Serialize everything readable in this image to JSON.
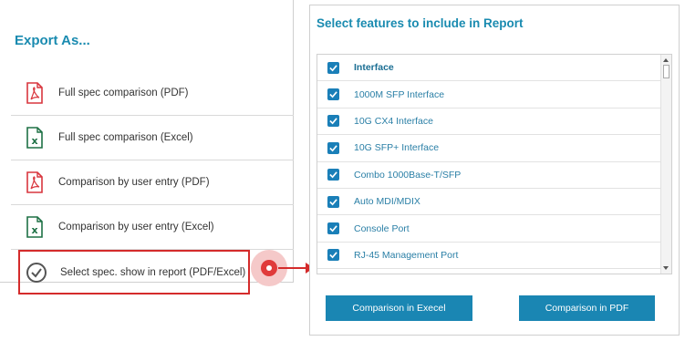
{
  "left_panel": {
    "title": "Export As...",
    "items": [
      {
        "label": "Full spec comparison (PDF)",
        "icon": "pdf-file-icon"
      },
      {
        "label": "Full spec comparison (Excel)",
        "icon": "excel-file-icon"
      },
      {
        "label": "Comparison by user entry (PDF)",
        "icon": "pdf-file-icon"
      },
      {
        "label": "Comparison by user entry (Excel)",
        "icon": "excel-file-icon"
      },
      {
        "label": "Select spec. show in report (PDF/Excel)",
        "icon": "check-circle-icon"
      }
    ]
  },
  "right_panel": {
    "title": "Select features to include in Report",
    "header": {
      "label": "Interface",
      "checked": true
    },
    "features": [
      {
        "label": "1000M SFP Interface",
        "checked": true
      },
      {
        "label": "10G CX4 Interface",
        "checked": true
      },
      {
        "label": "10G SFP+ Interface",
        "checked": true
      },
      {
        "label": "Combo 1000Base-T/SFP",
        "checked": true
      },
      {
        "label": "Auto MDI/MDIX",
        "checked": true
      },
      {
        "label": "Console Port",
        "checked": true
      },
      {
        "label": "RJ-45 Management Port",
        "checked": true
      }
    ],
    "buttons": {
      "excel": "Comparison in Execel",
      "pdf": "Comparison in PDF"
    }
  },
  "colors": {
    "accent": "#1a8bb0",
    "button": "#1a86b3",
    "highlight": "#d42b2b",
    "pdf_icon": "#d9363e",
    "excel_icon": "#1e7145"
  }
}
